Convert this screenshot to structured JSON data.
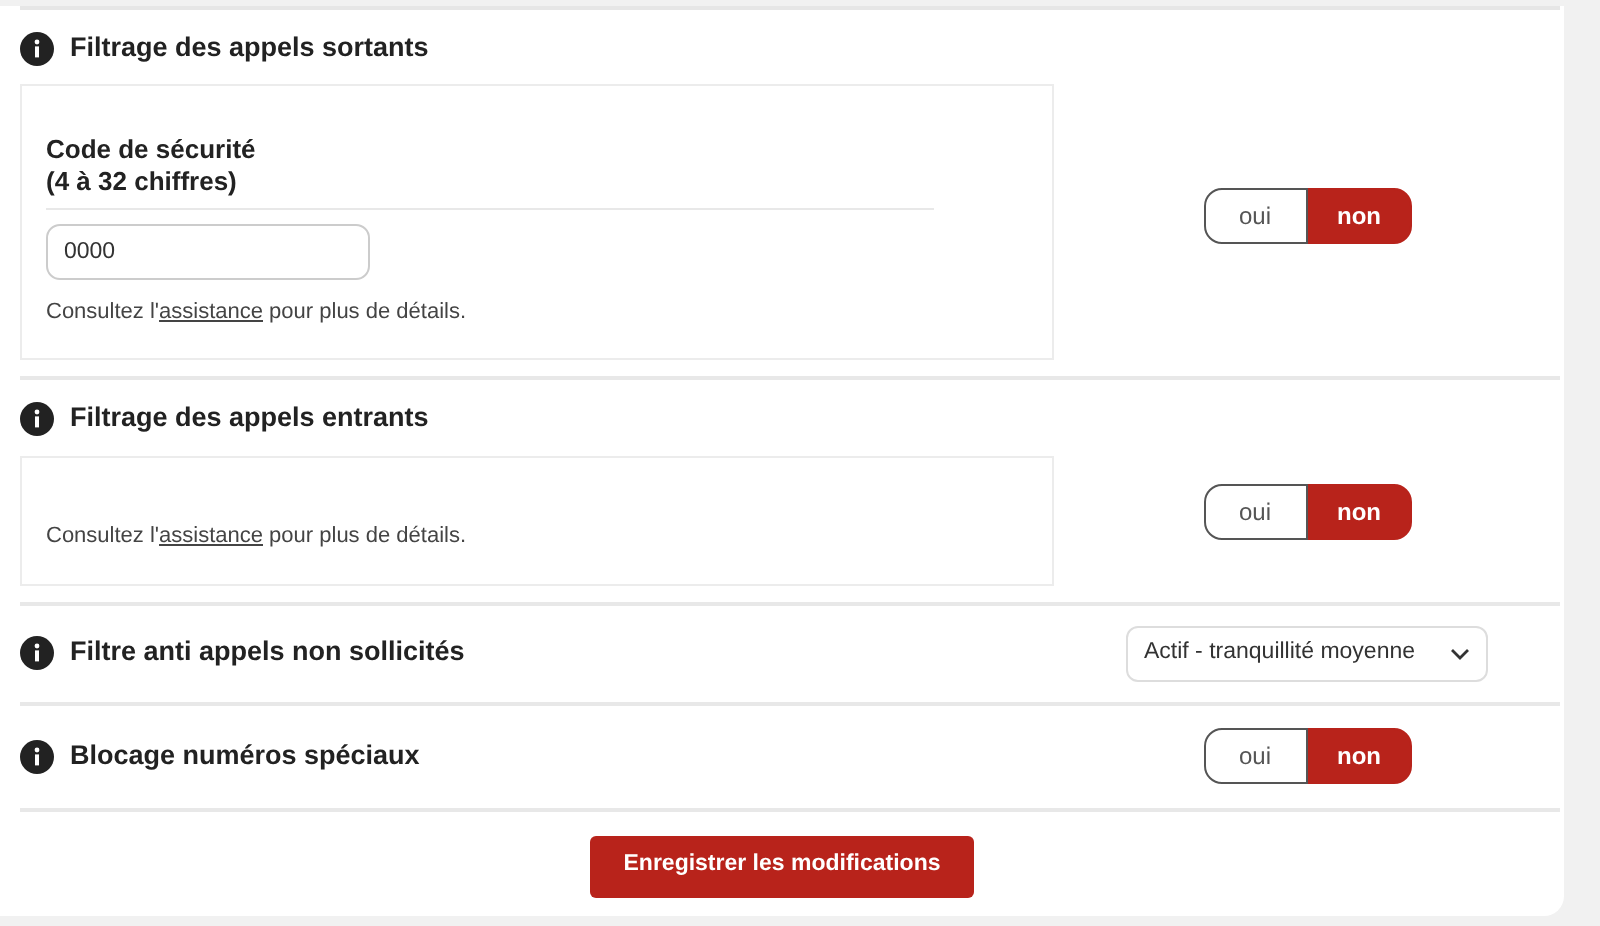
{
  "sections": [
    {
      "kind": "toggle",
      "title": "Filtrage des appels sortants",
      "panel": {
        "field_label": "Code de sécurité",
        "field_label_2": "(4 à 32 chiffres)",
        "field_value": "0000",
        "help": {
          "before": "Consultez l'",
          "link": "assistance",
          "after": " pour plus de détails."
        }
      },
      "options": [
        {
          "label": "oui",
          "selected": false
        },
        {
          "label": "non",
          "selected": true
        }
      ]
    },
    {
      "kind": "toggle",
      "title": "Filtrage des appels entrants",
      "panel": {
        "help": {
          "before": "Consultez l'",
          "link": "assistance",
          "after": " pour plus de détails."
        }
      },
      "options": [
        {
          "label": "oui",
          "selected": false
        },
        {
          "label": "non",
          "selected": true
        }
      ]
    },
    {
      "kind": "select",
      "title": "Filtre anti appels non sollicités",
      "value": "Actif - tranquillité moyenne"
    },
    {
      "kind": "toggle",
      "title": "Blocage numéros spéciaux",
      "options": [
        {
          "label": "oui",
          "selected": false
        },
        {
          "label": "non",
          "selected": true
        }
      ]
    }
  ],
  "save_button": "Enregistrer les modifications"
}
